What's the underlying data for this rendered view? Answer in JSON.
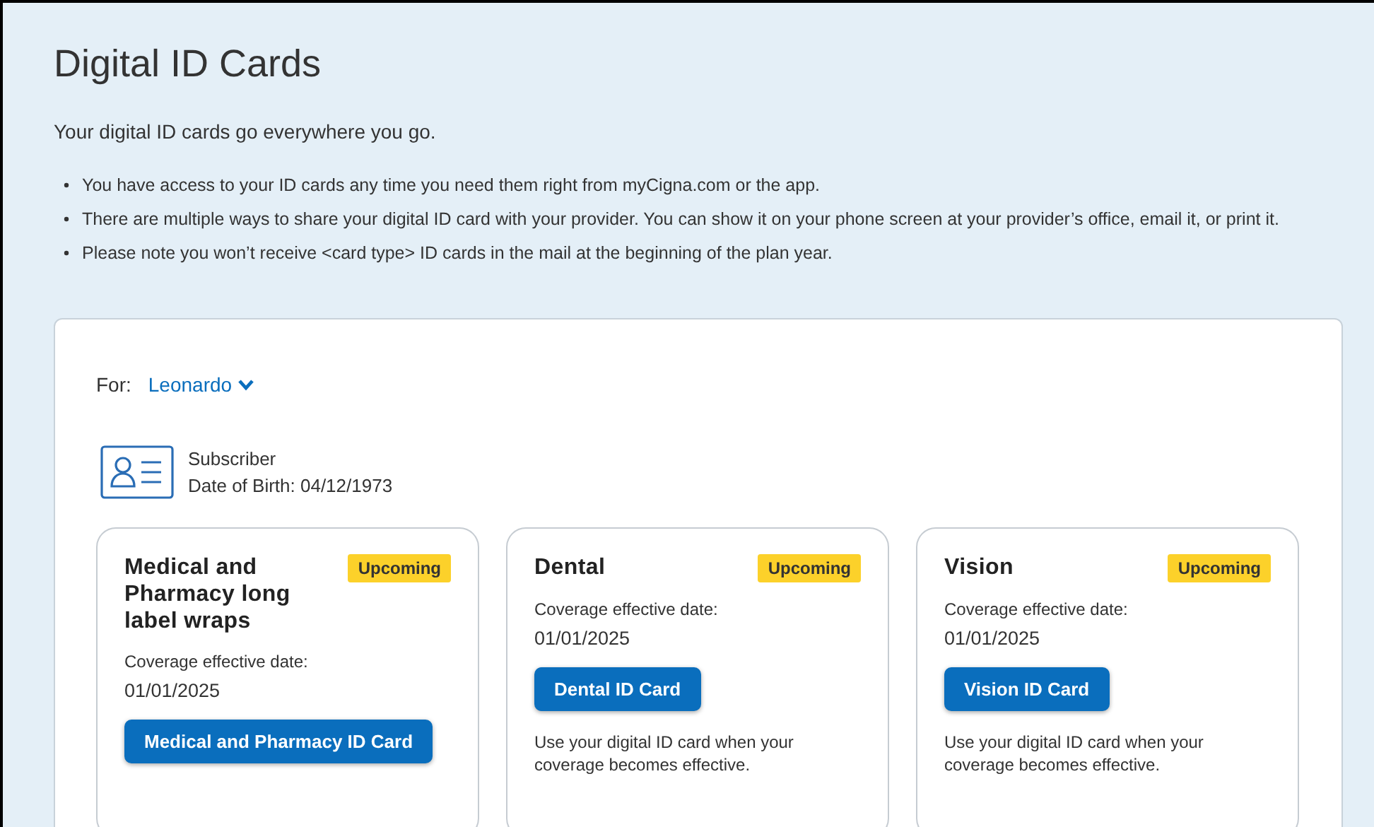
{
  "page": {
    "title": "Digital ID Cards",
    "intro": "Your digital ID cards go everywhere you go.",
    "bullets": [
      "You have access to your ID cards any time you need them right from myCigna.com or the app.",
      "There are multiple ways to share your digital ID card with your provider. You can show it on your phone screen at your provider’s office, email it, or print it.",
      "Please note you won’t receive <card type> ID cards in the mail at the beginning of the plan year."
    ]
  },
  "member": {
    "for_label": "For:",
    "name": "Leonardo",
    "role": "Subscriber",
    "dob": "Date of Birth: 04/12/1973"
  },
  "cards": [
    {
      "title": "Medical and Pharmacy long label wraps",
      "badge": "Upcoming",
      "coverage_label": "Coverage effective date:",
      "date": "01/01/2025",
      "button": "Medical and Pharmacy ID Card"
    },
    {
      "title": "Dental",
      "badge": "Upcoming",
      "coverage_label": "Coverage effective date:",
      "date": "01/01/2025",
      "button": "Dental ID Card",
      "note": "Use your digital ID card when your coverage becomes effective."
    },
    {
      "title": "Vision",
      "badge": "Upcoming",
      "coverage_label": "Coverage effective date:",
      "date": "01/01/2025",
      "button": "Vision ID Card",
      "note": "Use your digital ID card when your coverage becomes effective."
    }
  ]
}
